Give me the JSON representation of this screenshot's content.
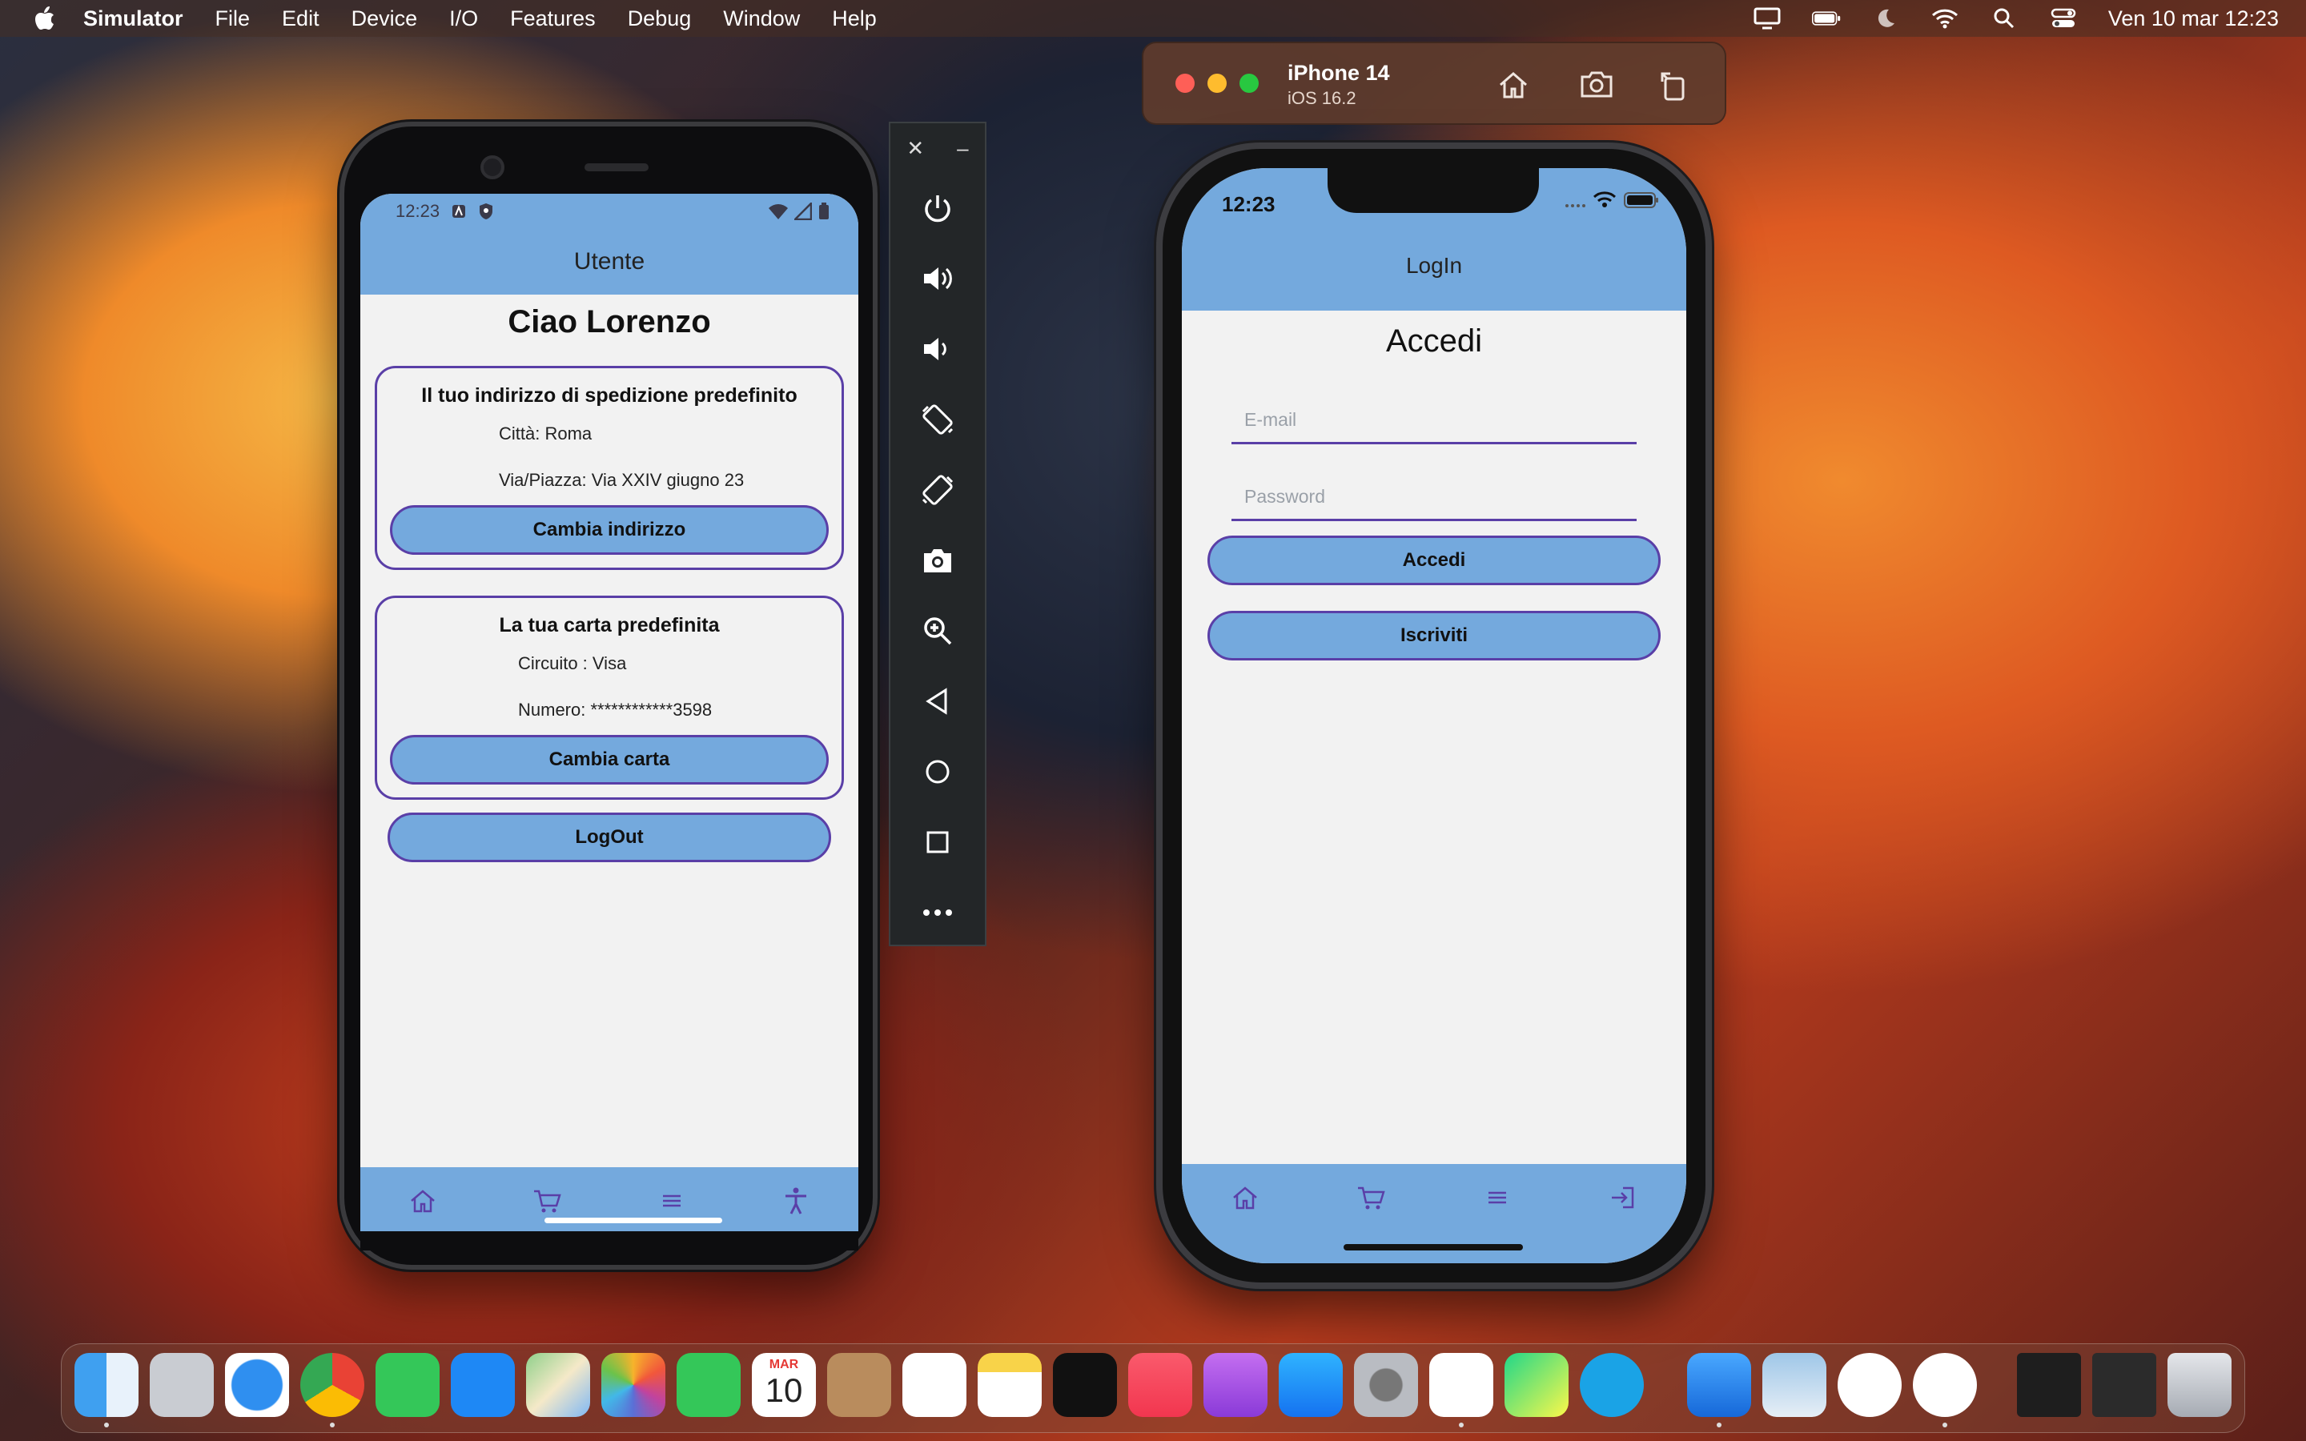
{
  "menubar": {
    "app_name": "Simulator",
    "items": [
      "File",
      "Edit",
      "Device",
      "I/O",
      "Features",
      "Debug",
      "Window",
      "Help"
    ],
    "datetime": "Ven 10 mar  12:23"
  },
  "simulator_window": {
    "device_name": "iPhone 14",
    "os_version": "iOS 16.2"
  },
  "android": {
    "status_time": "12:23",
    "header_title": "Utente",
    "greeting": "Ciao Lorenzo",
    "address_card": {
      "title": "Il tuo indirizzo di spedizione predefinito",
      "city": "Città: Roma",
      "street": "Via/Piazza: Via XXIV giugno 23",
      "button": "Cambia indirizzo"
    },
    "payment_card": {
      "title": "La tua carta predefinita",
      "circuit": "Circuito : Visa",
      "number": "Numero: ************3598",
      "button": "Cambia carta"
    },
    "logout_button": "LogOut",
    "nav_icons": [
      "home-icon",
      "cart-icon",
      "menu-icon",
      "accessibility-icon"
    ]
  },
  "emulator_toolbar": {
    "close": "✕",
    "minimize": "–",
    "buttons": [
      "power",
      "volume-up",
      "volume-down",
      "rotate-left",
      "rotate-right",
      "camera",
      "zoom",
      "back",
      "home",
      "overview",
      "more"
    ]
  },
  "iphone": {
    "status_time": "12:23",
    "header_title": "LogIn",
    "heading": "Accedi",
    "email_placeholder": "E-mail",
    "password_placeholder": "Password",
    "login_button": "Accedi",
    "signup_button": "Iscriviti",
    "nav_icons": [
      "home-icon",
      "cart-icon",
      "menu-icon",
      "login-icon"
    ]
  },
  "dock": {
    "apps": [
      "Finder",
      "Launchpad",
      "Safari",
      "Chrome",
      "Messages",
      "Mail",
      "Maps",
      "Photos",
      "FaceTime",
      "Calendar",
      "Contacts",
      "Reminders",
      "Notes",
      "TV",
      "Music",
      "Podcasts",
      "App Store",
      "System Settings",
      "VS Code",
      "PyCharm",
      "Skype",
      "Xcode",
      "Preview",
      "Android Studio",
      "Simulator",
      "Terminal",
      "Console",
      "Trash"
    ],
    "calendar_month": "MAR",
    "calendar_day": "10"
  },
  "colors": {
    "app_bar": "#74a9dd",
    "accent_border": "#5a3fa7",
    "nav_icon": "#5a3fa7"
  }
}
